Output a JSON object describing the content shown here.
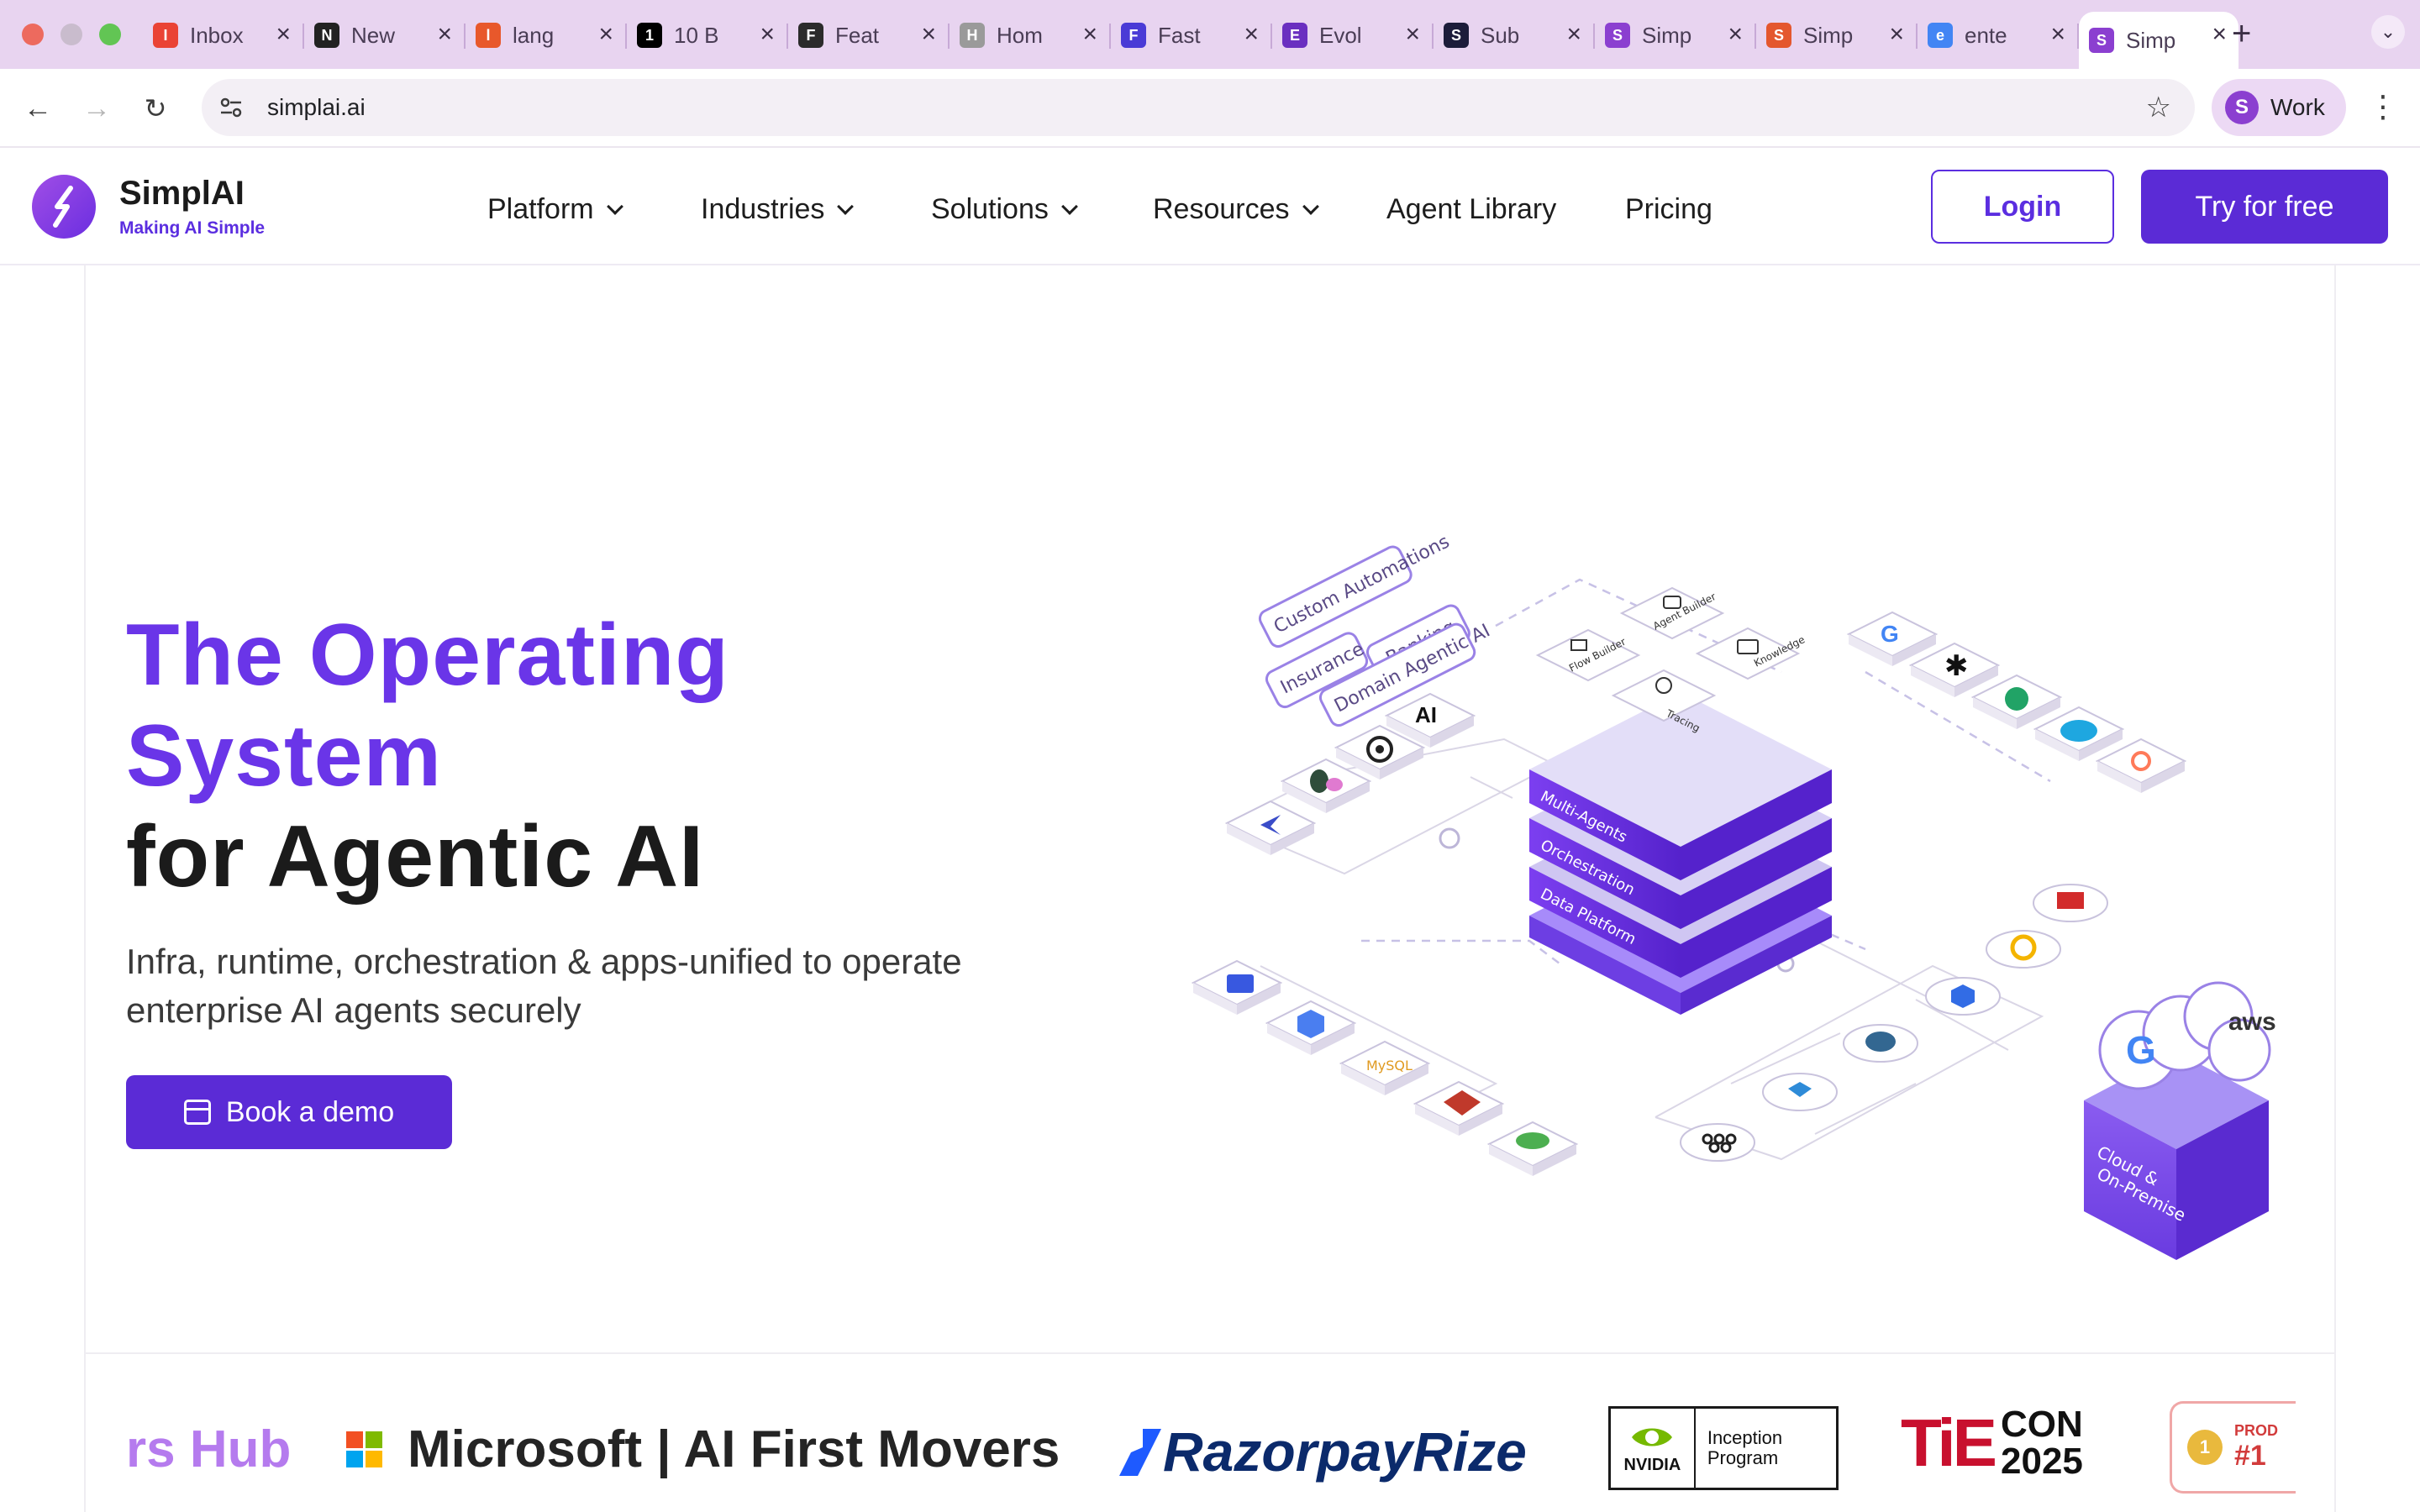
{
  "browser": {
    "tabs": [
      {
        "label": "Inbox",
        "favicon": "gmail-icon",
        "color": "#ea4335"
      },
      {
        "label": "New",
        "favicon": "lines-icon",
        "color": "#222222"
      },
      {
        "label": "lang",
        "favicon": "swirl-icon",
        "color": "#e8582b"
      },
      {
        "label": "10 B",
        "favicon": "medium-icon",
        "color": "#000000"
      },
      {
        "label": "Feat",
        "favicon": "ai-icon",
        "color": "#2b2b2b"
      },
      {
        "label": "Hom",
        "favicon": "cloud-icon",
        "color": "#9a9a9a"
      },
      {
        "label": "Fast",
        "favicon": "fast-icon",
        "color": "#4a3bd6"
      },
      {
        "label": "Evol",
        "favicon": "evol-icon",
        "color": "#6a2fc0"
      },
      {
        "label": "Sub",
        "favicon": "ai-icon",
        "color": "#1c1c3a"
      },
      {
        "label": "Simp",
        "favicon": "simplai-icon",
        "color": "#8b3fd0"
      },
      {
        "label": "Simp",
        "favicon": "producthunt-icon",
        "color": "#e4572e"
      },
      {
        "label": "ente",
        "favicon": "google-icon",
        "color": "#4285f4"
      },
      {
        "label": "Simp",
        "favicon": "simplai-icon",
        "color": "#8b3fd0"
      }
    ],
    "url": "simplai.ai",
    "profile_name": "Work"
  },
  "site": {
    "brand": "SimplAI",
    "tagline": "Making AI Simple",
    "nav": [
      {
        "label": "Platform",
        "dropdown": true
      },
      {
        "label": "Industries",
        "dropdown": true
      },
      {
        "label": "Solutions",
        "dropdown": true
      },
      {
        "label": "Resources",
        "dropdown": true
      },
      {
        "label": "Agent Library",
        "dropdown": false
      },
      {
        "label": "Pricing",
        "dropdown": false
      }
    ],
    "login_label": "Login",
    "try_label": "Try for free"
  },
  "hero": {
    "title_line1": "The Operating",
    "title_line2": "System",
    "title_line3": "for Agentic AI",
    "subtitle": "Infra, runtime, orchestration & apps-unified to operate enterprise AI agents securely",
    "cta_label": "Book a demo",
    "illustration": {
      "chips": [
        "Custom Automations",
        "Banking",
        "Insurance",
        "Domain Agentic AI"
      ],
      "tiles": [
        "Flow Builder",
        "Agent Builder",
        "Tracing",
        "Knowledge"
      ],
      "layers": [
        "Multi-Agents",
        "Orchestration",
        "Data Platform"
      ],
      "cloud_label": [
        "Cloud &",
        "On-Premise"
      ]
    }
  },
  "partners": {
    "hub": "rs Hub",
    "microsoft": "Microsoft | AI First Movers",
    "razorpay": "RazorpayRize",
    "nvidia_name": "NVIDIA",
    "nvidia_program": "Inception Program",
    "tie_mark": "TiE",
    "tie_con": "CON",
    "tie_year": "2025",
    "prod_badge": "PROD",
    "prod_rank": "#1",
    "prod_medal": "1"
  },
  "colors": {
    "accent": "#5b2bd6",
    "title_purple": "#6a35e8",
    "tabstrip": "#e8d4f0"
  }
}
